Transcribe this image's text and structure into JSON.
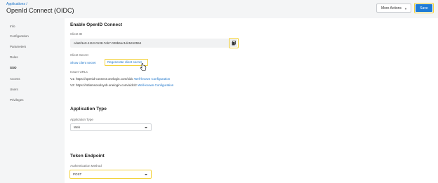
{
  "header": {
    "breadcrumb": "Applications /",
    "title": "OpenId Connect (OIDC)",
    "more_actions_label": "More Actions",
    "more_actions_chevron": "▼",
    "save_label": "Save"
  },
  "sidebar": {
    "items": [
      {
        "label": "Info"
      },
      {
        "label": "Configuration"
      },
      {
        "label": "Parameters"
      },
      {
        "label": "Rules"
      },
      {
        "label": "SSO"
      },
      {
        "label": "Access"
      },
      {
        "label": "Users"
      },
      {
        "label": "Privileges"
      }
    ],
    "active": "SSO"
  },
  "sso": {
    "section_title": "Enable OpenID Connect",
    "client_id_label": "Client ID",
    "client_id_value": "cda5f1e0-4113-0138-7eb7-028b6ec1dc5410554",
    "client_secret_label": "Client Secret",
    "show_secret_link": "Show client secret",
    "regenerate_link": "Regenerate client secret",
    "issuer_label": "Issuer URLs",
    "issuer_v1_prefix": "V1: https://openid-connect.onelogin.com/oidc",
    "issuer_v1_link": "Well-known Configuration",
    "issuer_v2_prefix": "V2: https://rstlamsosolsysb.onelogin.com/oidc/2",
    "issuer_v2_link": "Well-known Configuration"
  },
  "application_type": {
    "section_title": "Application Type",
    "field_label": "Application Type",
    "selected": "Web"
  },
  "token_endpoint": {
    "section_title": "Token Endpoint",
    "field_label": "Authentication Method",
    "selected": "POST"
  },
  "colors": {
    "accent": "#1e7bd6",
    "highlight": "#f3d23a",
    "link": "#1a73c9"
  },
  "icons": {
    "copy": "copy-icon",
    "cursor": "hand-pointer-icon"
  }
}
